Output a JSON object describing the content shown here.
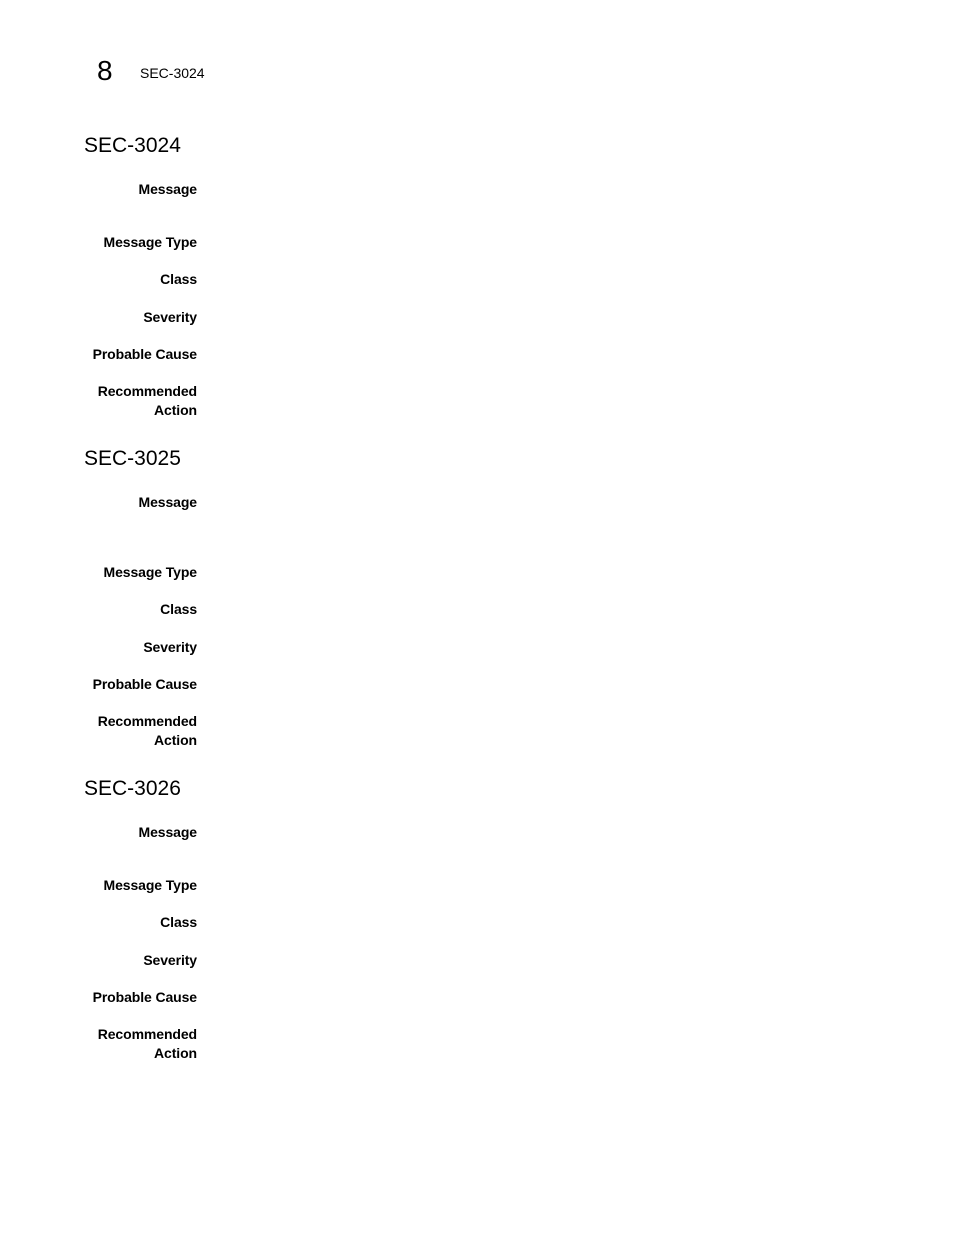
{
  "header": {
    "chapter_number": "8",
    "running_head": "SEC-3024"
  },
  "sections": [
    {
      "id": "SEC-3024",
      "fields": [
        {
          "label": "Message",
          "value": ""
        },
        {
          "label": "Message Type",
          "value": ""
        },
        {
          "label": "Class",
          "value": ""
        },
        {
          "label": "Severity",
          "value": ""
        },
        {
          "label": "Probable Cause",
          "value": ""
        },
        {
          "label_line1": "Recommended",
          "label_line2": "Action",
          "value": ""
        }
      ]
    },
    {
      "id": "SEC-3025",
      "fields": [
        {
          "label": "Message",
          "value": ""
        },
        {
          "label": "Message Type",
          "value": ""
        },
        {
          "label": "Class",
          "value": ""
        },
        {
          "label": "Severity",
          "value": ""
        },
        {
          "label": "Probable Cause",
          "value": ""
        },
        {
          "label_line1": "Recommended",
          "label_line2": "Action",
          "value": ""
        }
      ]
    },
    {
      "id": "SEC-3026",
      "fields": [
        {
          "label": "Message",
          "value": ""
        },
        {
          "label": "Message Type",
          "value": ""
        },
        {
          "label": "Class",
          "value": ""
        },
        {
          "label": "Severity",
          "value": ""
        },
        {
          "label": "Probable Cause",
          "value": ""
        },
        {
          "label_line1": "Recommended",
          "label_line2": "Action",
          "value": ""
        }
      ]
    }
  ]
}
